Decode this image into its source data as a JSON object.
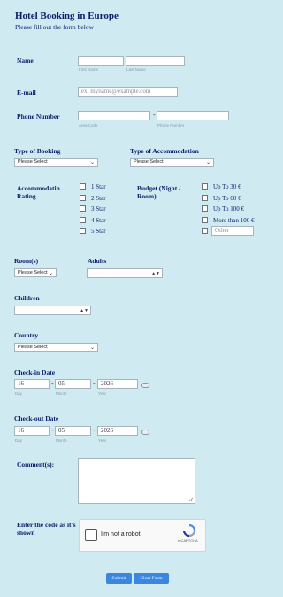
{
  "header": {
    "title": "Hotel Booking in Europe",
    "subtitle": "Please fill out the form below"
  },
  "name": {
    "label": "Name",
    "first_sub": "First Name",
    "last_sub": "Last Name",
    "first_value": "",
    "last_value": ""
  },
  "email": {
    "label": "E-mail",
    "placeholder": "ex: myname@example.com"
  },
  "phone": {
    "label": "Phone Number",
    "area_sub": "Area Code",
    "number_sub": "Phone Number",
    "dash": "-"
  },
  "booking": {
    "label": "Type of Booking",
    "selected": "Please Select"
  },
  "accommodation": {
    "label": "Type of Accommodation",
    "selected": "Please Select"
  },
  "rating": {
    "label": "Accommodatin Rating",
    "options": [
      "1 Star",
      "2 Star",
      "3 Star",
      "4 Star",
      "5 Star"
    ]
  },
  "budget": {
    "label": "Budget (Night / Room)",
    "options": [
      "Up To 30 €",
      "Up To 60 €",
      "Up To 100 €",
      "More than 100 €"
    ],
    "other_placeholder": "Other"
  },
  "rooms": {
    "label": "Room(s)",
    "selected": "Please Select"
  },
  "adults": {
    "label": "Adults"
  },
  "children": {
    "label": "Children"
  },
  "country": {
    "label": "Country",
    "selected": "Please Select"
  },
  "checkin": {
    "label": "Check-in Date",
    "day": "16",
    "month": "05",
    "year": "2026",
    "day_sub": "Day",
    "month_sub": "Month",
    "year_sub": "Year"
  },
  "checkout": {
    "label": "Check-out Date",
    "day": "16",
    "month": "05",
    "year": "2026",
    "day_sub": "Day",
    "month_sub": "Month",
    "year_sub": "Year"
  },
  "comments": {
    "label": "Comment(s):"
  },
  "captcha": {
    "label": "Enter the code as it's shown",
    "checkbox_label": "I'm not a robot",
    "brand": "reCAPTCHA"
  },
  "buttons": {
    "submit": "Submit",
    "clear": "Clear Form"
  },
  "icons": {
    "select": "chevron-down-icon",
    "spinner": "spinner-arrows-icon",
    "calendar": "calendar-icon",
    "recaptcha": "recaptcha-logo-icon"
  }
}
